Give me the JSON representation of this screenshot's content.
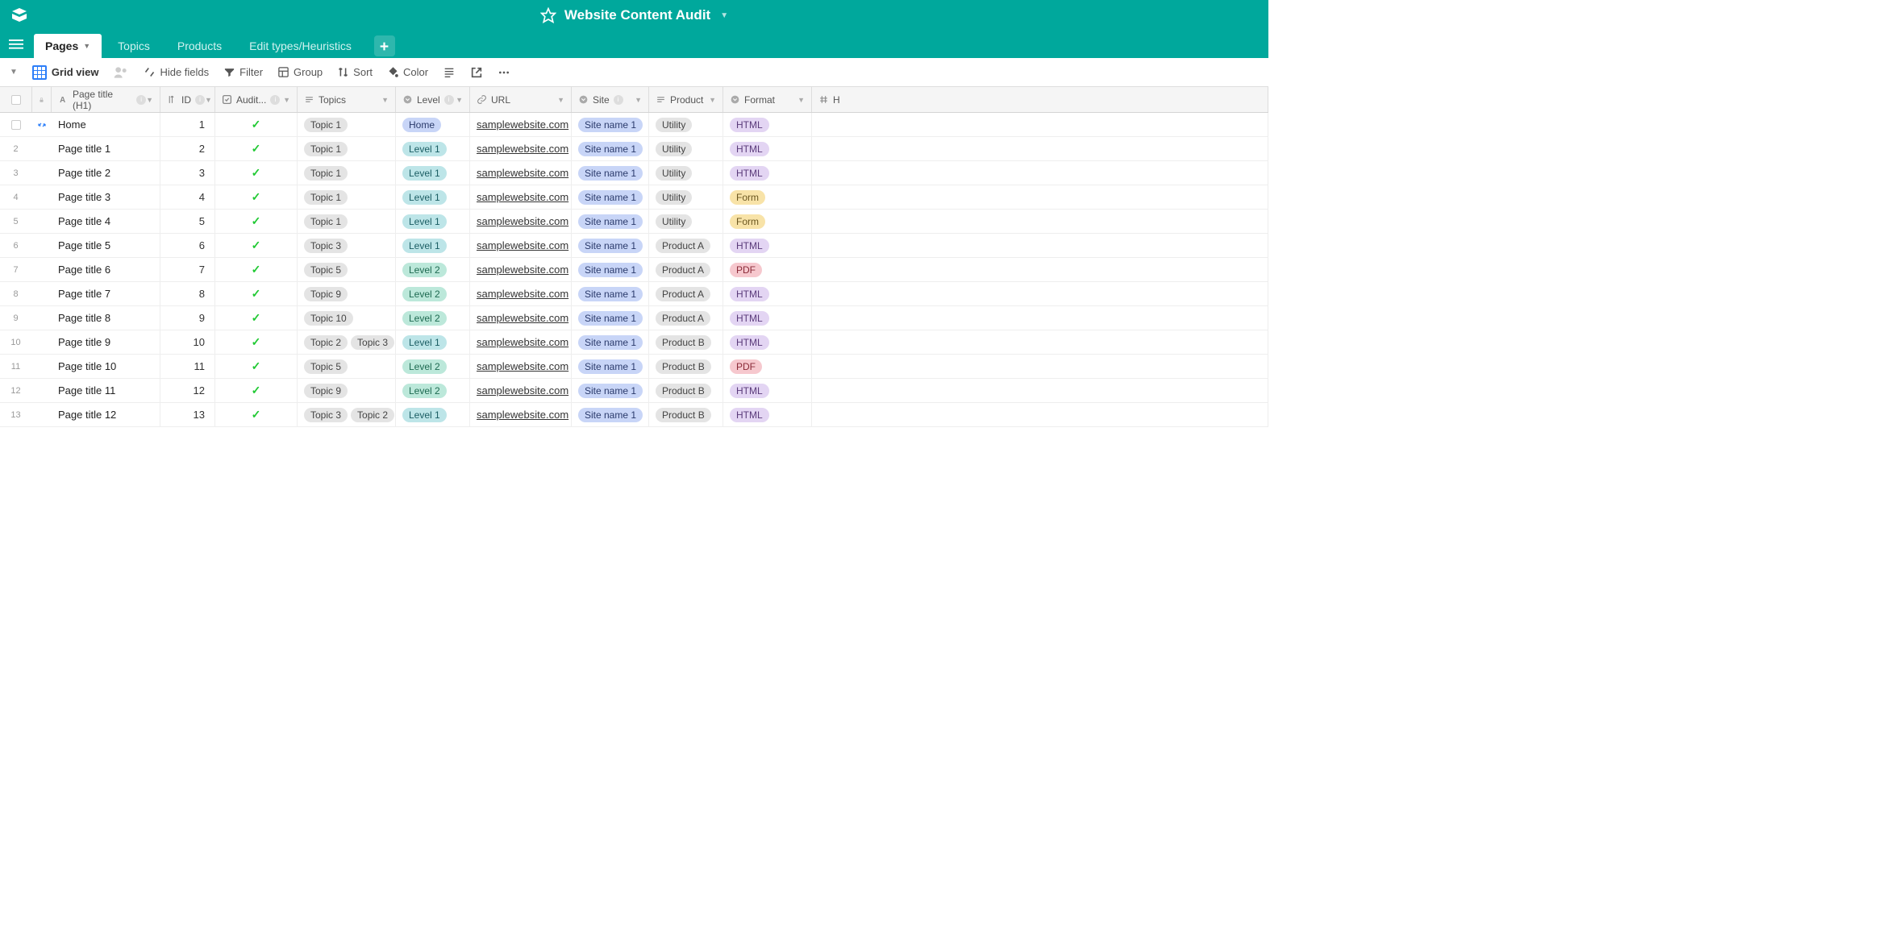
{
  "app_title": "Website Content Audit",
  "tabs": [
    {
      "label": "Pages",
      "active": true
    },
    {
      "label": "Topics",
      "active": false
    },
    {
      "label": "Products",
      "active": false
    },
    {
      "label": "Edit types/Heuristics",
      "active": false
    }
  ],
  "view_name": "Grid view",
  "toolbar": {
    "hide_fields": "Hide fields",
    "filter": "Filter",
    "group": "Group",
    "sort": "Sort",
    "color": "Color"
  },
  "columns": {
    "title": "Page title (H1)",
    "id": "ID",
    "audit": "Audit...",
    "topics": "Topics",
    "level": "Level",
    "url": "URL",
    "site": "Site",
    "product": "Product",
    "format": "Format",
    "extra": "H"
  },
  "rows": [
    {
      "n": 1,
      "title": "Home",
      "id": "1",
      "audit": true,
      "topics": [
        "Topic 1"
      ],
      "level": {
        "text": "Home",
        "cls": "pill-blue"
      },
      "url": "samplewebsite.com",
      "site": "Site name 1",
      "product": "Utility",
      "format": {
        "text": "HTML",
        "cls": "pill-purple"
      },
      "first": true
    },
    {
      "n": 2,
      "title": "Page title 1",
      "id": "2",
      "audit": true,
      "topics": [
        "Topic 1"
      ],
      "level": {
        "text": "Level 1",
        "cls": "pill-cyan"
      },
      "url": "samplewebsite.com",
      "site": "Site name 1",
      "product": "Utility",
      "format": {
        "text": "HTML",
        "cls": "pill-purple"
      }
    },
    {
      "n": 3,
      "title": "Page title 2",
      "id": "3",
      "audit": true,
      "topics": [
        "Topic 1"
      ],
      "level": {
        "text": "Level 1",
        "cls": "pill-cyan"
      },
      "url": "samplewebsite.com",
      "site": "Site name 1",
      "product": "Utility",
      "format": {
        "text": "HTML",
        "cls": "pill-purple"
      }
    },
    {
      "n": 4,
      "title": "Page title 3",
      "id": "4",
      "audit": true,
      "topics": [
        "Topic 1"
      ],
      "level": {
        "text": "Level 1",
        "cls": "pill-cyan"
      },
      "url": "samplewebsite.com",
      "site": "Site name 1",
      "product": "Utility",
      "format": {
        "text": "Form",
        "cls": "pill-yellow"
      }
    },
    {
      "n": 5,
      "title": "Page title 4",
      "id": "5",
      "audit": true,
      "topics": [
        "Topic 1"
      ],
      "level": {
        "text": "Level 1",
        "cls": "pill-cyan"
      },
      "url": "samplewebsite.com",
      "site": "Site name 1",
      "product": "Utility",
      "format": {
        "text": "Form",
        "cls": "pill-yellow"
      }
    },
    {
      "n": 6,
      "title": "Page title 5",
      "id": "6",
      "audit": true,
      "topics": [
        "Topic 3"
      ],
      "level": {
        "text": "Level 1",
        "cls": "pill-cyan"
      },
      "url": "samplewebsite.com",
      "site": "Site name 1",
      "product": "Product A",
      "format": {
        "text": "HTML",
        "cls": "pill-purple"
      }
    },
    {
      "n": 7,
      "title": "Page title 6",
      "id": "7",
      "audit": true,
      "topics": [
        "Topic 5"
      ],
      "level": {
        "text": "Level 2",
        "cls": "pill-mint"
      },
      "url": "samplewebsite.com",
      "site": "Site name 1",
      "product": "Product A",
      "format": {
        "text": "PDF",
        "cls": "pill-pink"
      }
    },
    {
      "n": 8,
      "title": "Page title 7",
      "id": "8",
      "audit": true,
      "topics": [
        "Topic 9"
      ],
      "level": {
        "text": "Level 2",
        "cls": "pill-mint"
      },
      "url": "samplewebsite.com",
      "site": "Site name 1",
      "product": "Product A",
      "format": {
        "text": "HTML",
        "cls": "pill-purple"
      }
    },
    {
      "n": 9,
      "title": "Page title 8",
      "id": "9",
      "audit": true,
      "topics": [
        "Topic 10"
      ],
      "level": {
        "text": "Level 2",
        "cls": "pill-mint"
      },
      "url": "samplewebsite.com",
      "site": "Site name 1",
      "product": "Product A",
      "format": {
        "text": "HTML",
        "cls": "pill-purple"
      }
    },
    {
      "n": 10,
      "title": "Page title 9",
      "id": "10",
      "audit": true,
      "topics": [
        "Topic 2",
        "Topic 3"
      ],
      "level": {
        "text": "Level 1",
        "cls": "pill-cyan"
      },
      "url": "samplewebsite.com",
      "site": "Site name 1",
      "product": "Product B",
      "format": {
        "text": "HTML",
        "cls": "pill-purple"
      }
    },
    {
      "n": 11,
      "title": "Page title 10",
      "id": "11",
      "audit": true,
      "topics": [
        "Topic 5"
      ],
      "level": {
        "text": "Level 2",
        "cls": "pill-mint"
      },
      "url": "samplewebsite.com",
      "site": "Site name 1",
      "product": "Product B",
      "format": {
        "text": "PDF",
        "cls": "pill-pink"
      }
    },
    {
      "n": 12,
      "title": "Page title 11",
      "id": "12",
      "audit": true,
      "topics": [
        "Topic 9"
      ],
      "level": {
        "text": "Level 2",
        "cls": "pill-mint"
      },
      "url": "samplewebsite.com",
      "site": "Site name 1",
      "product": "Product B",
      "format": {
        "text": "HTML",
        "cls": "pill-purple"
      }
    },
    {
      "n": 13,
      "title": "Page title 12",
      "id": "13",
      "audit": true,
      "topics": [
        "Topic 3",
        "Topic 2"
      ],
      "level": {
        "text": "Level 1",
        "cls": "pill-cyan"
      },
      "url": "samplewebsite.com",
      "site": "Site name 1",
      "product": "Product B",
      "format": {
        "text": "HTML",
        "cls": "pill-purple"
      }
    }
  ]
}
